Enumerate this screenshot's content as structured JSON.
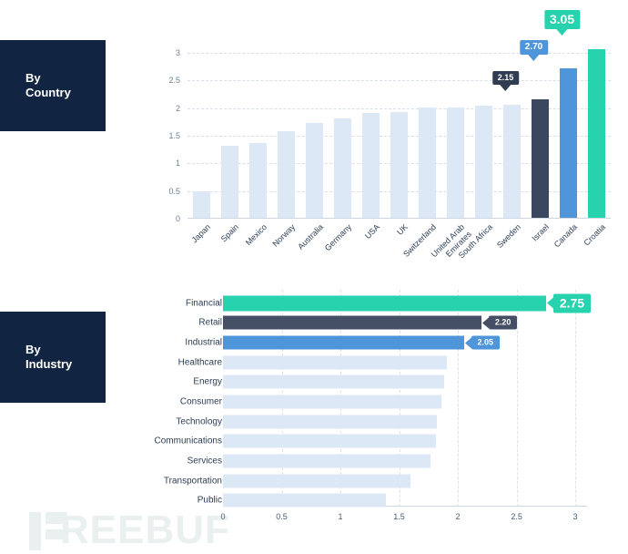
{
  "sections": [
    {
      "id": "country",
      "label_line1": "By",
      "label_line2": "Country"
    },
    {
      "id": "industry",
      "label_line1": "By",
      "label_line2": "Industry"
    }
  ],
  "watermark": {
    "text": "REEBUF"
  },
  "colors": {
    "navy_box": "#112542",
    "bar_default": "#dce8f5",
    "highlight_dark": "#3a475e",
    "highlight_blue": "#4e95d9",
    "highlight_teal": "#27d3ae",
    "axis_text": "#2c3e56",
    "grid": "#d9dfe6"
  },
  "chart_data": [
    {
      "id": "by-country",
      "type": "bar",
      "orientation": "vertical",
      "title": "By Country",
      "xlabel": "",
      "ylabel": "",
      "ylim": [
        0,
        3.2
      ],
      "grid": true,
      "legend": "none",
      "ytick_labels": [
        "3",
        "2.5",
        "2",
        "1.5",
        "1",
        "0.5",
        "0"
      ],
      "ytick_values": [
        3,
        2.5,
        2,
        1.5,
        1,
        0.5,
        0
      ],
      "categories": [
        "Japan",
        "Spain",
        "Mexico",
        "Norway",
        "Australia",
        "Germany",
        "USA",
        "UK",
        "Switzerland",
        "United Arab Emirates",
        "South Africa",
        "Sweden",
        "Israel",
        "Canada",
        "Croatia"
      ],
      "values": [
        0.48,
        1.3,
        1.36,
        1.57,
        1.72,
        1.79,
        1.9,
        1.92,
        2.0,
        2.0,
        2.03,
        2.05,
        2.15,
        2.7,
        3.05
      ],
      "highlights": [
        {
          "category": "Israel",
          "value": 2.15,
          "label": "2.15",
          "color": "#3a475e"
        },
        {
          "category": "Canada",
          "value": 2.7,
          "label": "2.70",
          "color": "#4e95d9"
        },
        {
          "category": "Croatia",
          "value": 3.05,
          "label": "3.05",
          "color": "#27d3ae"
        }
      ]
    },
    {
      "id": "by-industry",
      "type": "bar",
      "orientation": "horizontal",
      "title": "By Industry",
      "xlabel": "",
      "ylabel": "",
      "xlim": [
        0,
        3.1
      ],
      "grid": true,
      "legend": "none",
      "xtick_labels": [
        "0",
        "0.5",
        "1",
        "1.5",
        "2",
        "2.5",
        "3"
      ],
      "xtick_values": [
        0,
        0.5,
        1,
        1.5,
        2,
        2.5,
        3
      ],
      "categories": [
        "Financial",
        "Retail",
        "Industrial",
        "Healthcare",
        "Energy",
        "Consumer",
        "Technology",
        "Communications",
        "Services",
        "Transportation",
        "Public"
      ],
      "values": [
        2.75,
        2.2,
        2.05,
        1.91,
        1.88,
        1.86,
        1.82,
        1.81,
        1.77,
        1.6,
        1.39
      ],
      "highlights": [
        {
          "category": "Financial",
          "value": 2.75,
          "label": "2.75",
          "color": "#27d3ae"
        },
        {
          "category": "Retail",
          "value": 2.2,
          "label": "2.20",
          "color": "#444f66"
        },
        {
          "category": "Industrial",
          "value": 2.05,
          "label": "2.05",
          "color": "#4e95d9"
        }
      ]
    }
  ]
}
